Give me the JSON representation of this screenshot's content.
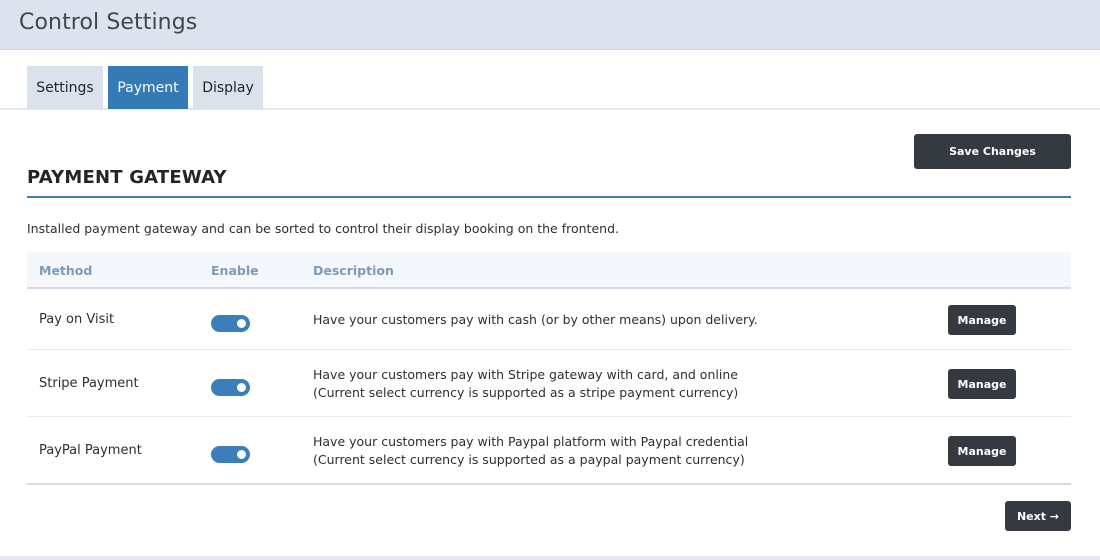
{
  "header": {
    "title": "Control Settings"
  },
  "tabs": [
    {
      "label": "Settings",
      "active": false
    },
    {
      "label": "Payment",
      "active": true
    },
    {
      "label": "Display",
      "active": false
    }
  ],
  "toolbar": {
    "save_label": "Save Changes"
  },
  "section": {
    "title": "PAYMENT GATEWAY",
    "description": "Installed payment gateway and can be sorted to control their display booking on the frontend."
  },
  "table": {
    "columns": [
      "Method",
      "Enable",
      "Description"
    ],
    "rows": [
      {
        "method": "Pay on Visit",
        "enabled": true,
        "description_line1": "Have your customers pay with cash (or by other means) upon delivery.",
        "description_line2": "",
        "action_label": "Manage"
      },
      {
        "method": "Stripe Payment",
        "enabled": true,
        "description_line1": "Have your customers pay with Stripe gateway with card, and online",
        "description_line2": "(Current select currency is supported as a stripe payment currency)",
        "action_label": "Manage"
      },
      {
        "method": "PayPal Payment",
        "enabled": true,
        "description_line1": "Have your customers pay with Paypal platform with Paypal credential",
        "description_line2": "(Current select currency is supported as a paypal payment currency)",
        "action_label": "Manage"
      }
    ]
  },
  "footer": {
    "next_label": "Next →"
  },
  "colors": {
    "accent": "#337ab7",
    "button_dark": "#343a40",
    "toggle_on": "#3b7dbd"
  }
}
